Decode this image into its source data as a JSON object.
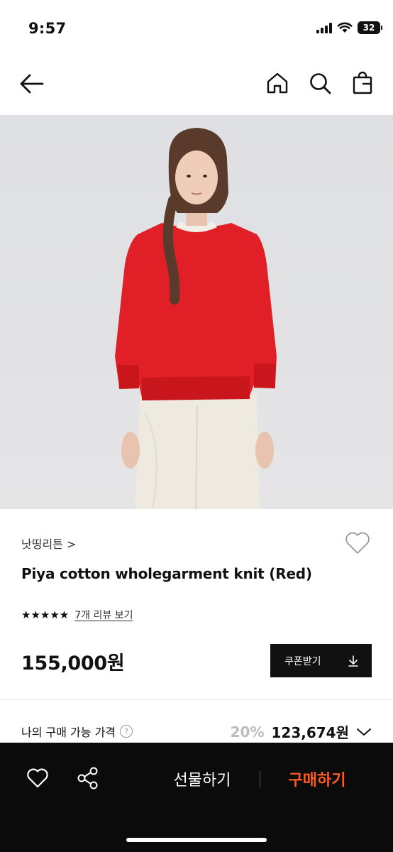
{
  "status": {
    "time": "9:57",
    "battery": "32"
  },
  "nav": {
    "back_icon": "arrow-left-icon",
    "home_icon": "home-icon",
    "search_icon": "search-icon",
    "bag_icon": "shopping-bag-icon"
  },
  "product": {
    "brand": "낫띵리튼 >",
    "title": "Piya cotton wholegarment knit (Red)",
    "stars": "★★★★★",
    "review_link": "7개 리뷰 보기",
    "price": "155,000원",
    "coupon_label": "쿠폰받기",
    "my_price_label": "나의 구매 가능 가격",
    "help_icon": "?",
    "discount": "20%",
    "final_price": "123,674원",
    "colors": {
      "sweater": "#e01f26",
      "pants": "#efebe1"
    }
  },
  "bottom_bar": {
    "gift_label": "선물하기",
    "buy_label": "구매하기",
    "buy_color": "#ff5a1f"
  }
}
